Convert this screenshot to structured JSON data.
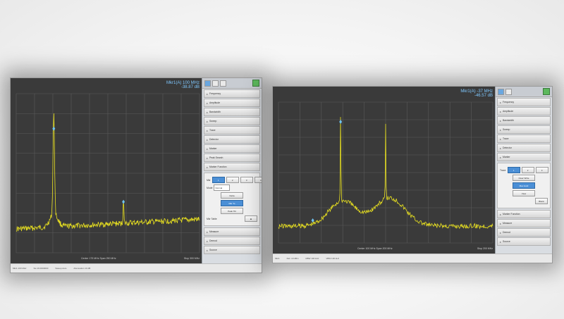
{
  "left_window": {
    "marker_line1": "Mkr1(A) 100 MHz",
    "marker_line2": "-38.87 dB",
    "center_label": "Center 175 MHz  Span 250 MHz",
    "stop_label": "Stop 300 MHz",
    "status_items": [
      "Mkr1 100 MHz",
      "Sw 16.0000000",
      "Sweep Auto",
      "Attenuation 10 dB"
    ],
    "menu_items": [
      "Frequency",
      "Amplitude",
      "Bandwidth",
      "Sweep",
      "Trace",
      "Detector",
      "Marker",
      "Peak Search",
      "Marker Function"
    ],
    "sub_menu": {
      "title": "Marker Function",
      "row1_label": "Mkr",
      "row1_buttons": [
        "1",
        "2",
        "3",
        "4",
        "5"
      ],
      "row2_label": "Mode",
      "row2_select": "Normal",
      "buttons": [
        "Delta",
        "Mkr To",
        "Peak Tbl"
      ],
      "row5_label": "Mkr Table"
    },
    "lower_items": [
      "Measure",
      "Demod",
      "Source"
    ]
  },
  "right_window": {
    "marker_line1": "Mkr1(A) -37 MHz",
    "marker_line2": "-46.57 dB",
    "center_label": "Center 100 MHz  Span 200 MHz",
    "stop_label": "Stop 200 MHz",
    "status_items": [
      "Mkr1",
      "Ref -10 dBm",
      "RBW 100 kHz",
      "VBW 100 kHz"
    ],
    "menu_items": [
      "Frequency",
      "Amplitude",
      "Bandwidth",
      "Sweep",
      "Trace",
      "Detector",
      "Marker"
    ],
    "sub_menu": {
      "row1_label": "Trace",
      "row1_buttons": [
        "1",
        "2",
        "3"
      ],
      "buttons": [
        "Clear Write",
        "Max Hold",
        "View"
      ],
      "blank_label": "Blank"
    },
    "lower_items": [
      "Marker Function",
      "Measure",
      "Demod",
      "Source"
    ]
  },
  "colors": {
    "trace": "#e8e020",
    "grid": "#5a5a5a",
    "screen_bg": "#3a3a3a",
    "marker": "#6fc3f0"
  },
  "icons": [
    "marker-diamond-icon",
    "flag-icon",
    "menu-arrow-icon"
  ]
}
